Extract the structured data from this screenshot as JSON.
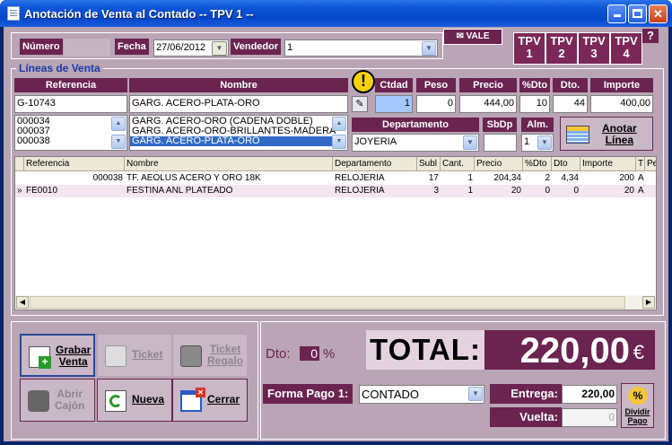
{
  "window": {
    "title": "Anotación de Venta al Contado -- TPV 1 --"
  },
  "header": {
    "numero_label": "Número",
    "numero_value": "",
    "fecha_label": "Fecha",
    "fecha_value": "27/06/2012",
    "vendedor_label": "Vendedor",
    "vendedor_value": "1",
    "vale_label": "VALE",
    "tpv_tabs": [
      {
        "label": "TPV",
        "num": "1"
      },
      {
        "label": "TPV",
        "num": "2"
      },
      {
        "label": "TPV",
        "num": "3"
      },
      {
        "label": "TPV",
        "num": "4"
      }
    ],
    "help_label": "?"
  },
  "lines": {
    "section_title": "Líneas de Venta",
    "referencia_label": "Referencia",
    "referencia_value": "G-10743",
    "nombre_label": "Nombre",
    "nombre_value": "GARG. ACERO-PLATA-ORO",
    "ref_list": [
      "000034",
      "000037",
      "000038"
    ],
    "name_list": [
      "GARG. ACERO-ORO (CADENA DOBLE)",
      "GARG. ACERO-ORO-BRILLANTES-MADERA",
      "GARG. ACERO-PLATA-ORO"
    ],
    "ctdad_label": "Ctdad",
    "ctdad_value": "1",
    "peso_label": "Peso",
    "peso_value": "0",
    "precio_label": "Precio",
    "precio_value": "444,00",
    "pdto_label": "%Dto",
    "pdto_value": "10",
    "dto_label": "Dto.",
    "dto_value": "44",
    "importe_label": "Importe",
    "importe_value": "400,00",
    "departamento_label": "Departamento",
    "departamento_value": "JOYERIA",
    "sbdp_label": "SbDp",
    "sbdp_value": "",
    "alm_label": "Alm.",
    "alm_value": "1",
    "anotar_label_1": "Anotar",
    "anotar_label_2": "Línea"
  },
  "grid": {
    "columns": [
      "Referencia",
      "Nombre",
      "Departamento",
      "Subl",
      "Cant.",
      "Precio",
      "%Dto",
      "Dto",
      "Importe",
      "T",
      "Pe"
    ],
    "rows": [
      {
        "marker": "",
        "ref": "000038",
        "nombre": "TF. AEOLUS ACERO Y ORO 18K",
        "depto": "RELOJERIA",
        "subl": "17",
        "cant": "1",
        "precio": "204,34",
        "pdto": "2",
        "dto": "4,34",
        "importe": "200",
        "t": "A"
      },
      {
        "marker": "»",
        "ref": "FE0010",
        "nombre": "FESTINA ANL PLATEADO",
        "depto": "RELOJERIA",
        "subl": "3",
        "cant": "1",
        "precio": "20",
        "pdto": "0",
        "dto": "0",
        "importe": "20",
        "t": "A"
      }
    ]
  },
  "buttons": {
    "grabar_1": "Grabar",
    "grabar_2": "Venta",
    "ticket": "Ticket",
    "ticket_regalo_1": "Ticket",
    "ticket_regalo_2": "Regalo",
    "abrir_1": "Abrir",
    "abrir_2": "Cajón",
    "nueva": "Nueva",
    "cerrar": "Cerrar"
  },
  "totals": {
    "dto_label": "Dto:",
    "dto_value": "0",
    "dto_unit": "%",
    "total_label": "TOTAL:",
    "total_value": "220,00",
    "currency": "€",
    "forma_pago_label": "Forma Pago 1:",
    "forma_pago_value": "CONTADO",
    "entrega_label": "Entrega:",
    "entrega_value": "220,00",
    "vuelta_label": "Vuelta:",
    "vuelta_value": "0",
    "dividir_1": "Dividir",
    "dividir_2": "Pago"
  }
}
